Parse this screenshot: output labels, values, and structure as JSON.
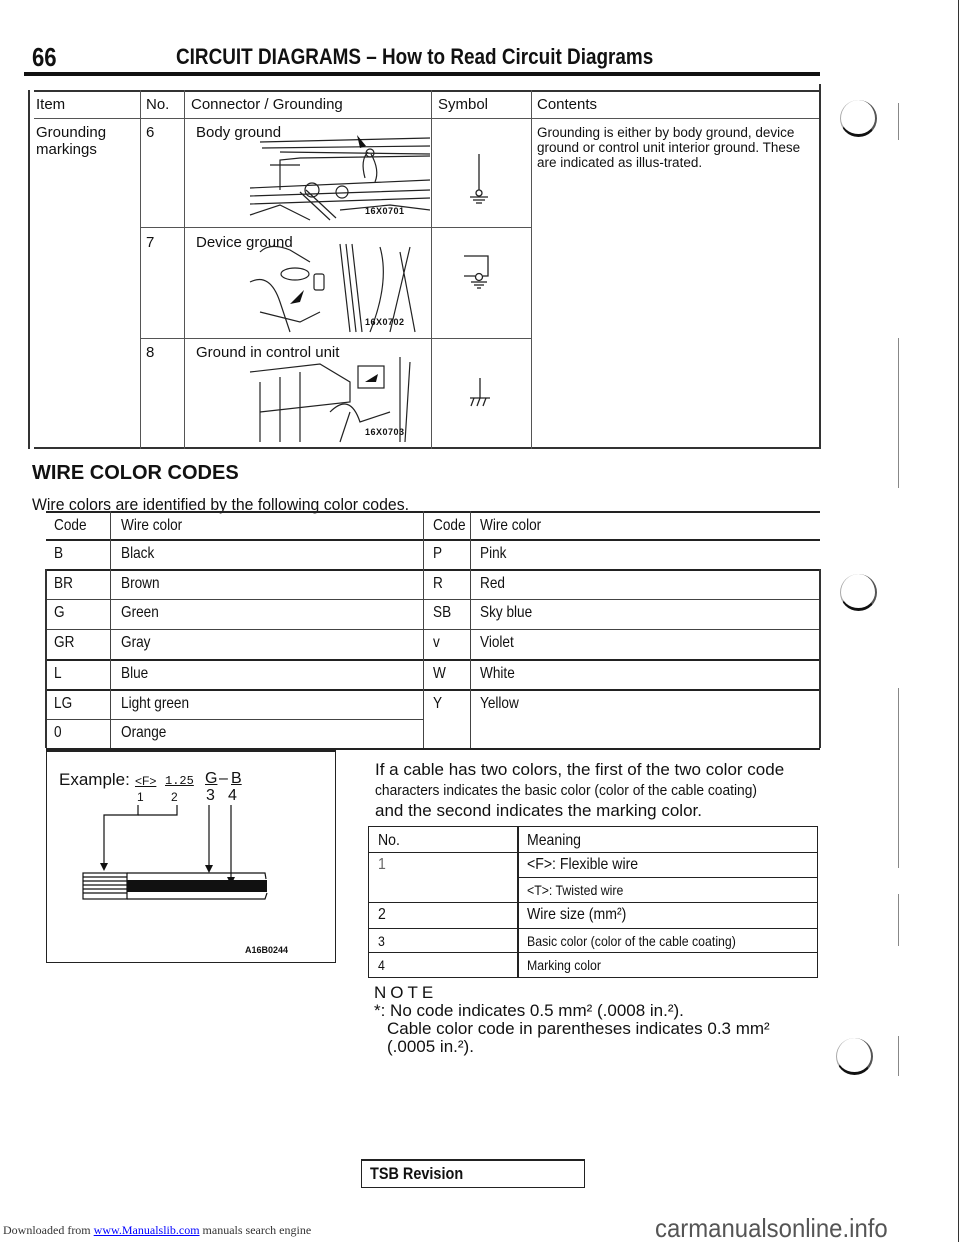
{
  "header": {
    "page_number": "66",
    "title": "CIRCUIT DIAGRAMS – How to Read Circuit Diagrams"
  },
  "grounding_table": {
    "columns": [
      "Item",
      "No.",
      "Connector / Grounding",
      "Symbol",
      "Contents"
    ],
    "item": "Grounding markings",
    "contents": "Grounding is either by body ground, device ground or control unit interior ground. These are indicated as illus-trated.",
    "rows": [
      {
        "no": "6",
        "label": "Body ground",
        "figure_code": "16X0701",
        "symbol": "body-ground-symbol"
      },
      {
        "no": "7",
        "label": "Device ground",
        "figure_code": "16X0702",
        "symbol": "device-ground-symbol"
      },
      {
        "no": "8",
        "label": "Ground in control unit",
        "figure_code": "16X0703",
        "symbol": "control-unit-ground-symbol"
      }
    ]
  },
  "wire_color_section": {
    "title": "WIRE COLOR CODES",
    "subtitle": "Wire colors are identified by the following color codes.",
    "headers": [
      "Code",
      "Wire color",
      "Code",
      "Wire color"
    ],
    "rows": [
      {
        "code1": "B",
        "color1": "Black",
        "code2": "P",
        "color2": "Pink"
      },
      {
        "code1": "BR",
        "color1": "Brown",
        "code2": "R",
        "color2": "Red"
      },
      {
        "code1": "G",
        "color1": "Green",
        "code2": "SB",
        "color2": "Sky blue"
      },
      {
        "code1": "GR",
        "color1": "Gray",
        "code2": "v",
        "color2": "Violet"
      },
      {
        "code1": "L",
        "color1": "Blue",
        "code2": "W",
        "color2": "White"
      },
      {
        "code1": "LG",
        "color1": "Light green",
        "code2": "Y",
        "color2": "Yellow"
      },
      {
        "code1": "0",
        "color1": "Orange",
        "code2": "",
        "color2": ""
      }
    ]
  },
  "example": {
    "label": "Example:",
    "parts": [
      "<F>",
      "1.25",
      "G",
      "–",
      "B"
    ],
    "numbers": [
      "1",
      "2",
      "3",
      "4"
    ],
    "figure_code": "A16B0244"
  },
  "explanation": {
    "line1": "If a cable has two colors, the first of the two color code",
    "line2": "characters indicates the basic color (color of the cable coating)",
    "line3": "and the second indicates the marking color."
  },
  "meaning_table": {
    "headers": [
      "No.",
      "Meaning"
    ],
    "rows": [
      {
        "no": "1",
        "meaning": "<F>: Flexible wire"
      },
      {
        "no": "",
        "meaning": "<T>: Twisted wire"
      },
      {
        "no": "2",
        "meaning": "Wire size (mm²)"
      },
      {
        "no": "3",
        "meaning": "Basic color (color of the cable coating)"
      },
      {
        "no": "4",
        "meaning": "Marking color"
      }
    ]
  },
  "note": {
    "title": "NOTE",
    "line1": "*: No code indicates 0.5 mm² (.0008 in.²).",
    "line2": "Cable color code in parentheses indicates 0.3 mm²",
    "line3": "(.0005 in.²)."
  },
  "footer": {
    "tsb_label": "TSB Revision",
    "downloaded_prefix": "Downloaded from ",
    "downloaded_link": "www.Manualslib.com",
    "downloaded_suffix": " manuals search engine",
    "watermark": "carmanualsonline.info"
  }
}
